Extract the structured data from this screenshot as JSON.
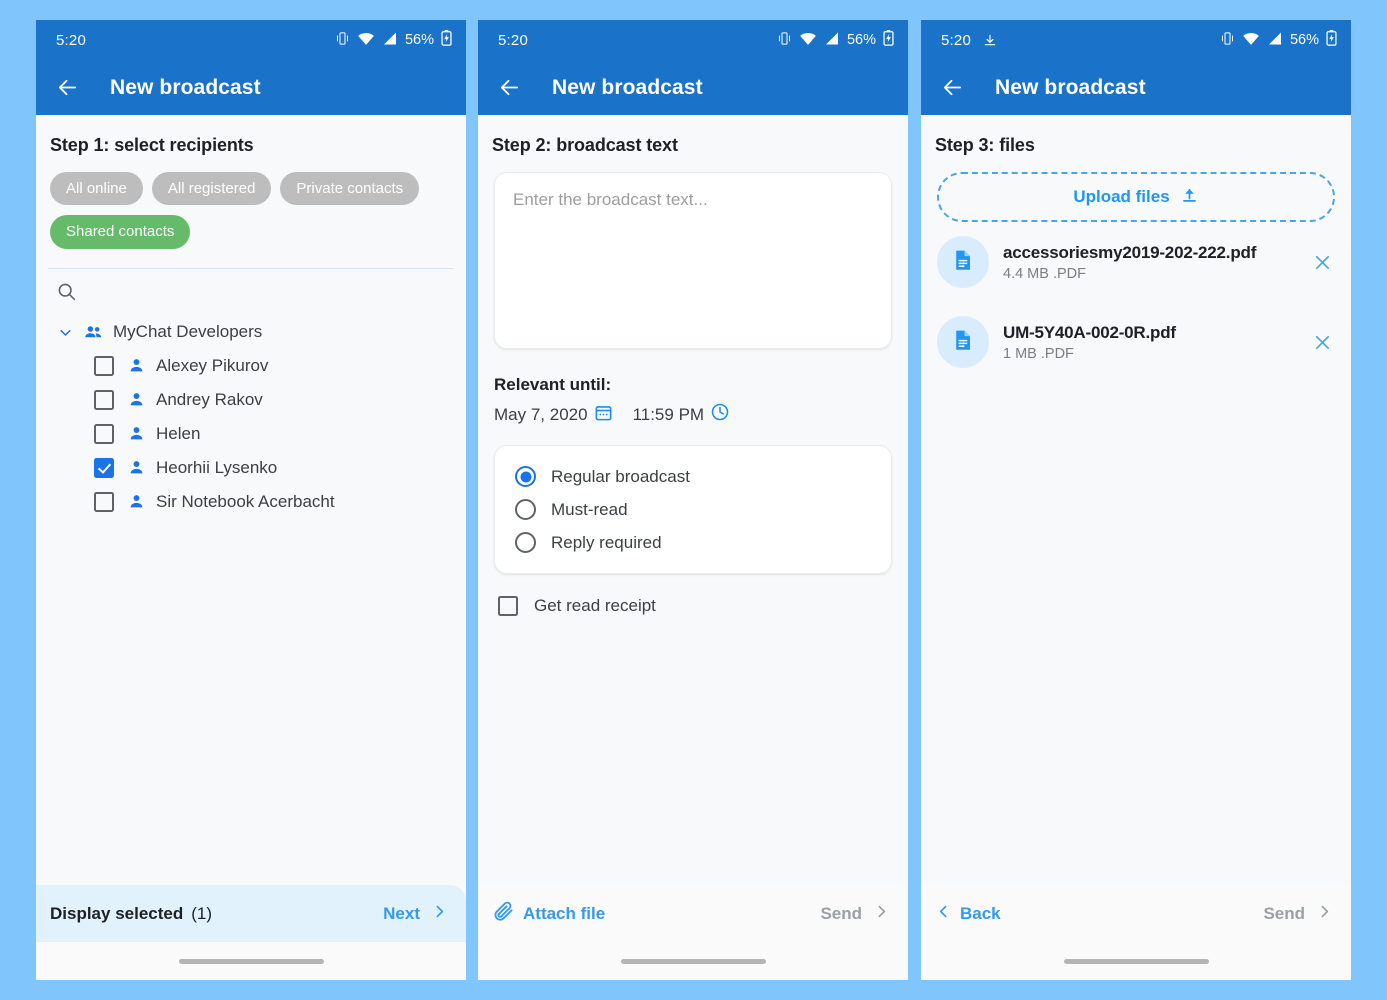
{
  "app": {
    "title": "New broadcast",
    "accent_blue": "#1a73c8",
    "link_blue": "#339af0",
    "chip_selected_green": "#66bb6a",
    "page_background": "#80c5fc"
  },
  "status_bar": {
    "time": "5:20",
    "battery": "56%",
    "icons": [
      "vibrate-icon",
      "wifi-icon",
      "signal-icon",
      "battery-icon"
    ],
    "panel3_extra_icon": "upload-indicator-icon"
  },
  "panel1": {
    "step_title": "Step 1: select recipients",
    "chips": [
      {
        "label": "All online",
        "selected": false
      },
      {
        "label": "All registered",
        "selected": false
      },
      {
        "label": "Private contacts",
        "selected": false
      },
      {
        "label": "Shared contacts",
        "selected": true
      }
    ],
    "search_placeholder": "",
    "group": {
      "name": "MyChat Developers",
      "expanded": true,
      "contacts": [
        {
          "name": "Alexey Pikurov",
          "checked": false
        },
        {
          "name": "Andrey Rakov",
          "checked": false
        },
        {
          "name": "Helen",
          "checked": false
        },
        {
          "name": "Heorhii Lysenko",
          "checked": true
        },
        {
          "name": "Sir Notebook Acerbacht",
          "checked": false
        }
      ]
    },
    "footer": {
      "display_selected_label": "Display selected",
      "selected_count": "(1)",
      "next_label": "Next"
    }
  },
  "panel2": {
    "step_title": "Step 2: broadcast text",
    "textarea_placeholder": "Enter the broadcast text...",
    "relevant": {
      "label": "Relevant until:",
      "date": "May 7, 2020",
      "time": "11:59 PM"
    },
    "broadcast_types": [
      {
        "label": "Regular broadcast",
        "selected": true
      },
      {
        "label": "Must-read",
        "selected": false
      },
      {
        "label": "Reply required",
        "selected": false
      }
    ],
    "read_receipt": {
      "label": "Get read receipt",
      "checked": false
    },
    "footer": {
      "attach_label": "Attach file",
      "send_label": "Send"
    }
  },
  "panel3": {
    "step_title": "Step 3: files",
    "upload_label": "Upload files",
    "files": [
      {
        "name": "accessoriesmy2019-202-222.pdf",
        "meta": "4.4 MB .PDF"
      },
      {
        "name": "UM-5Y40A-002-0R.pdf",
        "meta": "1 MB .PDF"
      }
    ],
    "footer": {
      "back_label": "Back",
      "send_label": "Send"
    }
  }
}
